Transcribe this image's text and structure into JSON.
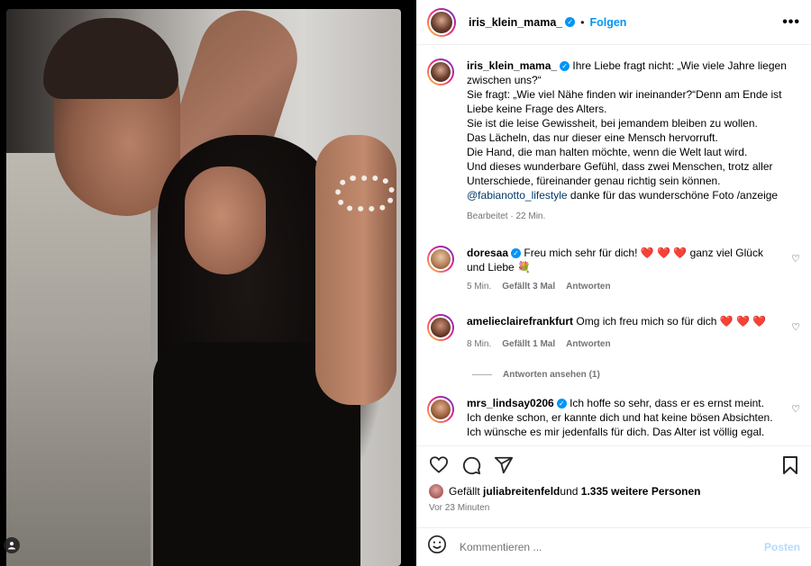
{
  "post": {
    "username": "iris_klein_mama_",
    "follow_label": "Folgen",
    "separator": "•",
    "more_label": "•••"
  },
  "caption": {
    "username": "iris_klein_mama_",
    "lines": [
      "Ihre Liebe fragt nicht: „Wie viele Jahre liegen zwischen uns?“",
      "Sie fragt: „Wie viel Nähe finden wir ineinander?“Denn am Ende ist Liebe keine Frage des Alters.",
      "Sie ist die leise Gewissheit, bei jemandem bleiben zu wollen.",
      "Das Lächeln, das nur dieser eine Mensch hervorruft.",
      "Die Hand, die man halten möchte, wenn die Welt laut wird.",
      "Und dieses wunderbare Gefühl, dass zwei Menschen, trotz aller Unterschiede, füreinander genau richtig sein können."
    ],
    "mention": "@fabianotto_lifestyle",
    "tail": " danke für das wunderschöne Foto /anzeige",
    "meta": "Bearbeitet · 22 Min."
  },
  "comments": [
    {
      "username": "doresaa",
      "text": "Freu mich sehr für dich! ",
      "emoji": "❤️ ❤️ ❤️",
      "text2": " ganz viel Glück und Liebe 💐",
      "time": "5 Min.",
      "likes": "Gefällt 3 Mal",
      "reply": "Antworten"
    },
    {
      "username": "amelieclairefrankfurt",
      "text": "Omg ich freu mich so für dich ",
      "emoji": "❤️ ❤️ ❤️",
      "text2": "",
      "time": "8 Min.",
      "likes": "Gefällt 1 Mal",
      "reply": "Antworten",
      "view_replies": "Antworten ansehen (1)"
    },
    {
      "username": "mrs_lindsay0206",
      "text": "Ich hoffe so sehr, dass er es ernst meint. Ich denke schon, er kannte dich und hat keine bösen Absichten. Ich wünsche es mir jedenfalls für dich. Das Alter ist völlig egal. Zeige ihn bitte auch niemals weiter hier. So merkt"
    }
  ],
  "likes": {
    "prefix": "Gefällt ",
    "user": "juliabreitenfeld",
    "middle": " und ",
    "count": "1.335 weitere Personen"
  },
  "posted_ago": "Vor 23 Minuten",
  "composer": {
    "placeholder": "Kommentieren ...",
    "post_label": "Posten"
  },
  "icons": {
    "heart": "♡",
    "comment": "◯",
    "share": "➢",
    "save": "⚑",
    "smile": "☺",
    "user": "●"
  }
}
